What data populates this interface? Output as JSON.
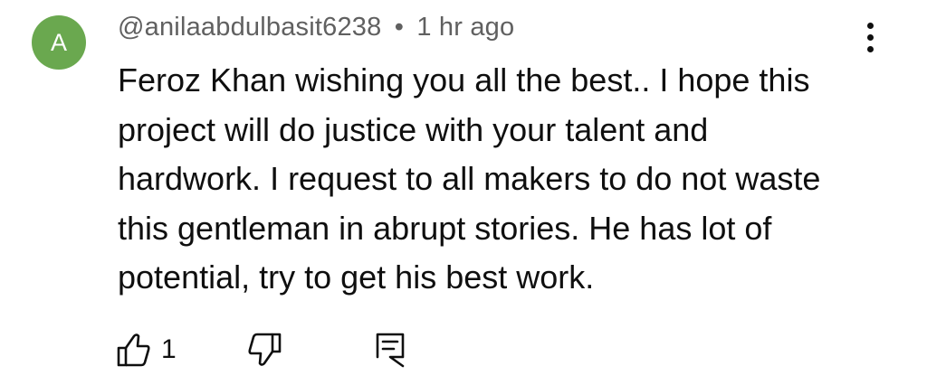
{
  "comment": {
    "avatar_letter": "A",
    "avatar_color": "#6aa84f",
    "author": "@anilaabdulbasit6238",
    "separator": "•",
    "timestamp": "1 hr ago",
    "text": "Feroz Khan wishing you all the best.. I hope this\nproject will do  justice with your talent and\nhardwork. I request to all makers to do not waste\nthis gentleman in abrupt stories. He has lot of\npotential, try to get his best work.",
    "like_count": "1"
  },
  "icons": {
    "more": "more-vert-icon",
    "like": "thumbs-up-icon",
    "dislike": "thumbs-down-icon",
    "reply": "reply-comment-icon"
  }
}
